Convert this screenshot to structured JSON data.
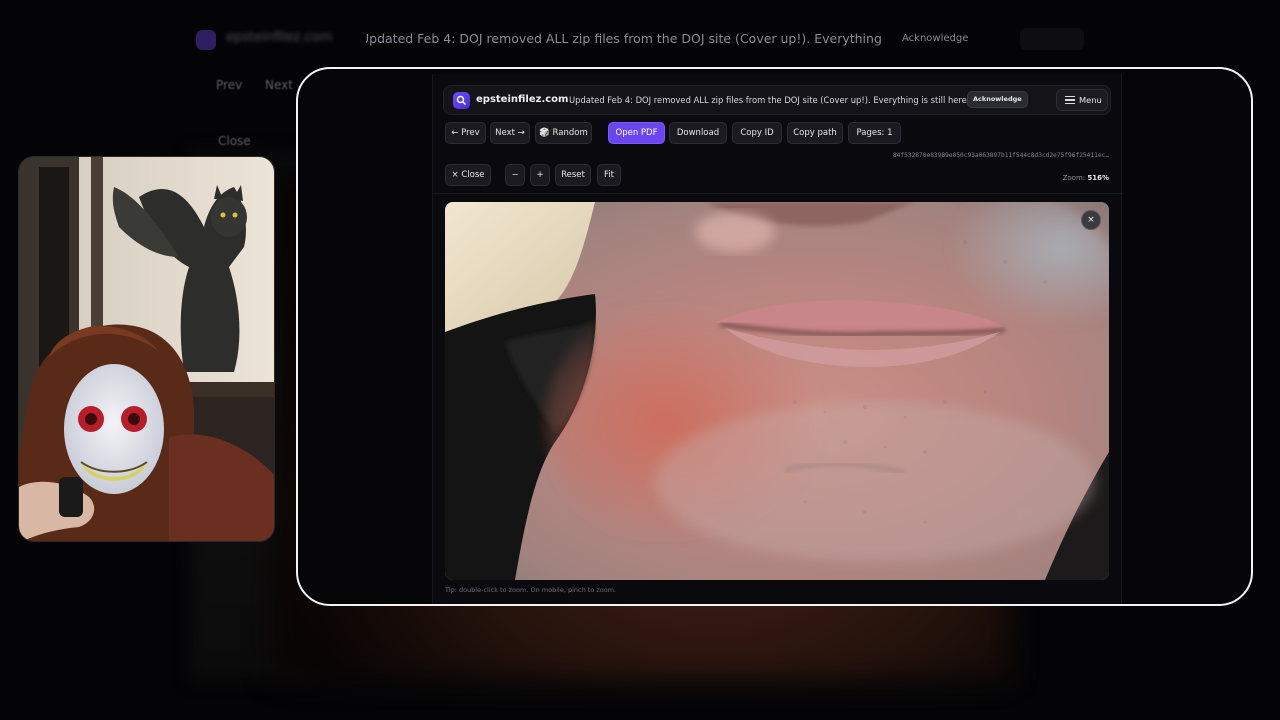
{
  "background": {
    "brand": "epsteinfilez.com",
    "banner": "Updated Feb 4: DOJ removed ALL zip files from the DOJ site (Cover up!). Everything is still here on this site.",
    "ack": "Acknowledge",
    "prev": "Prev",
    "next": "Next",
    "close": "Close"
  },
  "header": {
    "brand": "epsteinfilez.com",
    "banner": "Updated Feb 4: DOJ removed ALL zip files from the DOJ site (Cover up!). Everything is still here on this site.",
    "acknowledge_label": "Acknowledge",
    "menu_label": "Menu"
  },
  "toolbar": {
    "prev_label": "← Prev",
    "next_label": "Next →",
    "random_label": "🎲 Random",
    "open_pdf_label": "Open PDF",
    "download_label": "Download",
    "copy_id_label": "Copy ID",
    "copy_path_label": "Copy path",
    "pages_label": "Pages: 1",
    "file_hash": "84f532870e83989e050c93a063897b11f544c8d3cd2e75f96f25411ec…"
  },
  "zoom_controls": {
    "close_label": "× Close",
    "zoom_out_label": "−",
    "zoom_in_label": "+",
    "reset_label": "Reset",
    "fit_label": "Fit",
    "zoom_prefix": "Zoom:",
    "zoom_value": "516%"
  },
  "viewer": {
    "close_label": "×",
    "tip": "Tip: double-click to zoom. On mobile, pinch to zoom."
  },
  "colors": {
    "accent": "#6a45f0",
    "frame": "#f3f3f3",
    "app_bg": "#0a0a0e"
  }
}
